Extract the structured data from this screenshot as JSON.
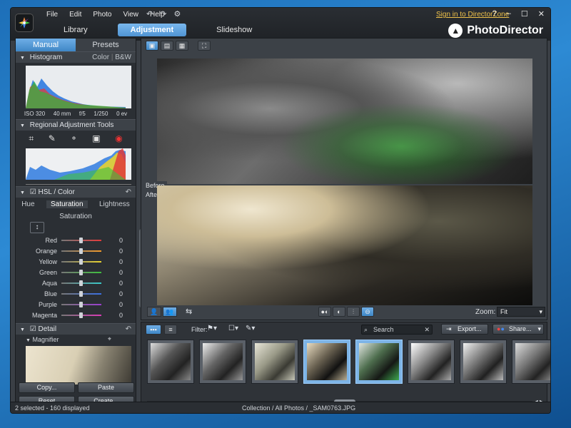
{
  "menu": [
    "File",
    "Edit",
    "Photo",
    "View",
    "Help"
  ],
  "signin": "Sign in to DirectorZone",
  "window_controls": [
    "?",
    "–",
    "☐",
    "✕"
  ],
  "modes": [
    {
      "label": "Library",
      "active": false
    },
    {
      "label": "Adjustment",
      "active": true
    },
    {
      "label": "Slideshow",
      "active": false
    }
  ],
  "brand": "PhotoDirector",
  "left_tabs": [
    {
      "label": "Manual",
      "active": true
    },
    {
      "label": "Presets",
      "active": false
    }
  ],
  "histogram": {
    "title": "Histogram",
    "mode_color": "Color",
    "mode_bw": "B&W",
    "exif": [
      "ISO 320",
      "40 mm",
      "f/5",
      "1/250",
      "0 ev"
    ]
  },
  "regional": {
    "title": "Regional Adjustment Tools"
  },
  "hsl": {
    "title": "HSL / Color",
    "tabs": [
      "Hue",
      "Saturation",
      "Lightness"
    ],
    "subtitle": "Saturation",
    "rows": [
      {
        "label": "Red",
        "value": "0",
        "color": "#e33b3b"
      },
      {
        "label": "Orange",
        "value": "0",
        "color": "#f39a2a"
      },
      {
        "label": "Yellow",
        "value": "0",
        "color": "#e7d230"
      },
      {
        "label": "Green",
        "value": "0",
        "color": "#3fbf3f"
      },
      {
        "label": "Aqua",
        "value": "0",
        "color": "#39c9c9"
      },
      {
        "label": "Blue",
        "value": "0",
        "color": "#3a6fe3"
      },
      {
        "label": "Purple",
        "value": "0",
        "color": "#9b3fd0"
      },
      {
        "label": "Magenta",
        "value": "0",
        "color": "#d83cb5"
      }
    ]
  },
  "detail": {
    "title": "Detail",
    "magnifier": "Magnifier"
  },
  "panel_buttons": [
    "Copy...",
    "Paste",
    "Reset",
    "Create..."
  ],
  "ba": {
    "before": "Before",
    "after": "After"
  },
  "zoom": {
    "label": "Zoom:",
    "value": "Fit"
  },
  "filter": {
    "label": "Filter:"
  },
  "search": {
    "placeholder": "Search"
  },
  "export_label": "Export...",
  "share_label": "Share...",
  "status": {
    "selected": "2 selected - 160 displayed",
    "path": "Collection / All Photos / _SAM0763.JPG"
  }
}
